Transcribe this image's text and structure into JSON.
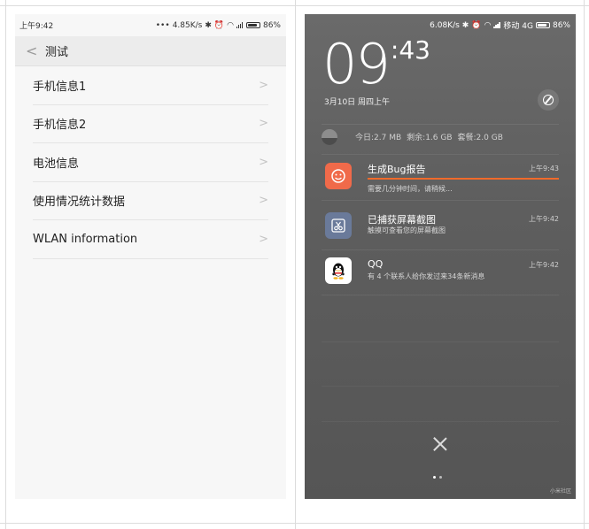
{
  "left_phone": {
    "status": {
      "time": "上午9:42",
      "network_speed": "4.85K/s",
      "battery": "86%"
    },
    "header": {
      "back_icon": "chevron-left-icon",
      "title": "测试"
    },
    "items": [
      {
        "label": "手机信息1"
      },
      {
        "label": "手机信息2"
      },
      {
        "label": "电池信息"
      },
      {
        "label": "使用情况统计数据"
      },
      {
        "label": "WLAN information"
      }
    ]
  },
  "right_phone": {
    "status": {
      "network_speed": "6.08K/s",
      "carrier": "移动 4G",
      "battery": "86%"
    },
    "clock": {
      "hour": "09",
      "minute": "43"
    },
    "date": "3月10日 周四上午",
    "data_usage": {
      "today": "今日:2.7 MB",
      "remaining": "剩余:1.6 GB",
      "plan": "套餐:2.0 GB"
    },
    "notifications": [
      {
        "icon": "smiley-icon",
        "title": "生成Bug报告",
        "body": "需要几分钟时间，请稍候...",
        "time": "上午9:43"
      },
      {
        "icon": "screenshot-icon",
        "title": "已捕获屏幕截图",
        "body": "触摸可查看您的屏幕截图",
        "time": "上午9:42"
      },
      {
        "icon": "qq-penguin-icon",
        "title": "QQ",
        "body": "有 4 个联系人给你发过来34条新消息",
        "time": "上午9:42"
      }
    ],
    "watermark": "小米社区"
  }
}
